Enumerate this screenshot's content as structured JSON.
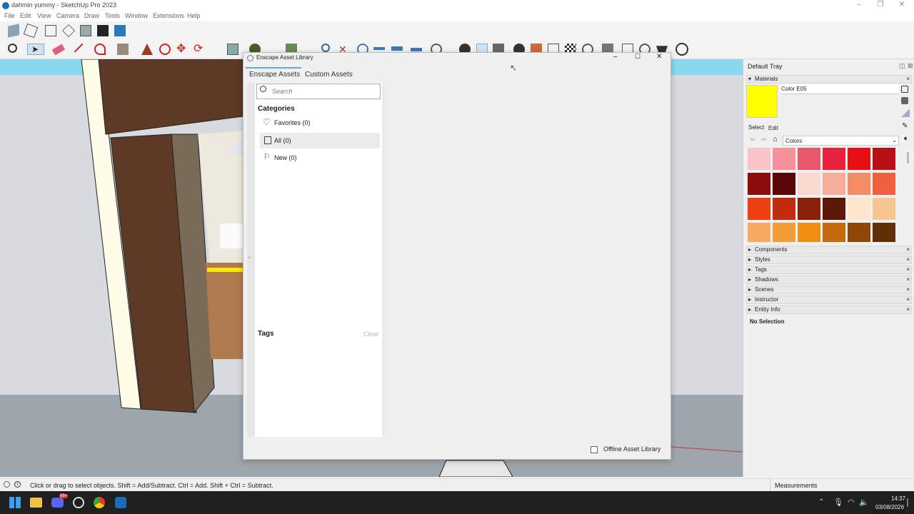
{
  "window": {
    "title": "dahmin yummy - SketchUp Pro 2023",
    "min": "–",
    "max": "❐",
    "close": "✕"
  },
  "menu": [
    "File",
    "Edit",
    "View",
    "Camera",
    "Draw",
    "Tools",
    "Window",
    "Extensions",
    "Help"
  ],
  "dialog": {
    "title": "Enscape Asset Library",
    "tabs": [
      "Enscape Assets",
      "Custom Assets"
    ],
    "search_placeholder": "Search",
    "categories_heading": "Categories",
    "categories": [
      "Favorites (0)",
      "All (0)",
      "New (0)"
    ],
    "tags_heading": "Tags",
    "clear_label": "Clear",
    "offline_label": "Offline Asset Library",
    "collapse_glyph": "‹"
  },
  "tray": {
    "title": "Default Tray",
    "materials_label": "Materials",
    "material_name": "Color E05",
    "material_color": "#ffff00",
    "tab_select": "Select",
    "tab_edit": "Edit",
    "library": "Colors",
    "swatches": [
      "#f9c3c8",
      "#f5919a",
      "#e8576a",
      "#e8213c",
      "#e80f13",
      "#b80e15",
      "#8a0c0c",
      "#5a0606",
      "#fad9cf",
      "#f6ad9a",
      "#f48d66",
      "#f0603f",
      "#ee3f12",
      "#c12b0e",
      "#8c210a",
      "#5c1707",
      "#fde6cc",
      "#f7c793",
      "#f5aa5f",
      "#f59b38",
      "#f18f10",
      "#c56a0c",
      "#8f4808",
      "#5f3007"
    ],
    "sections": [
      "Components",
      "Styles",
      "Tags",
      "Shadows",
      "Scenes",
      "Instructor",
      "Entity Info"
    ],
    "entity_info": "No Selection"
  },
  "status": {
    "message": "Click or drag to select objects. Shift = Add/Subtract. Ctrl = Add. Shift + Ctrl = Subtract.",
    "measurements_label": "Measurements"
  },
  "taskbar": {
    "time": "14:37",
    "date": "03/08/2026",
    "badge": "99+"
  }
}
